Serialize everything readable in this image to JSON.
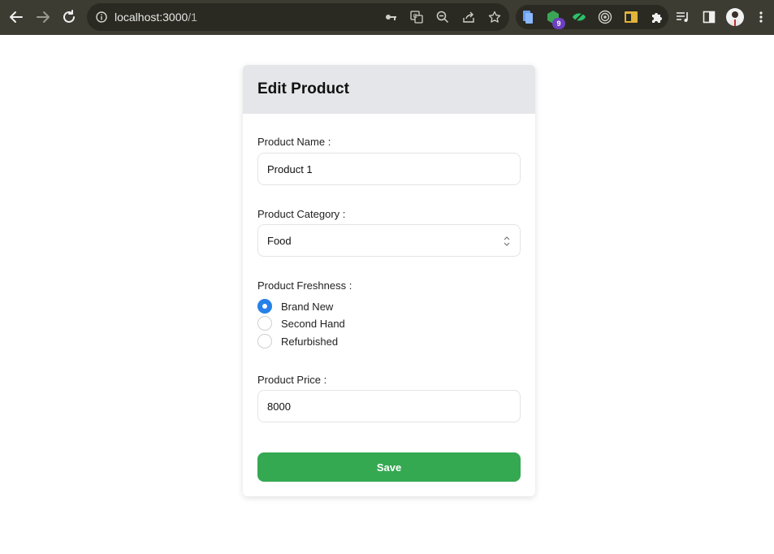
{
  "browser": {
    "url_host": "localhost:3000",
    "url_path": "/1",
    "extension_badge": "9",
    "icons": [
      "back-icon",
      "forward-icon",
      "reload-icon",
      "site-info-icon",
      "key-icon",
      "translate-icon",
      "zoom-out-icon",
      "share-icon",
      "bookmark-star-icon",
      "extension-icon",
      "puzzle-icon",
      "media-icon",
      "side-panel-icon",
      "menu-icon"
    ]
  },
  "form": {
    "title": "Edit Product",
    "name_label": "Product Name :",
    "name_value": "Product 1",
    "category_label": "Product Category :",
    "category_value": "Food",
    "freshness_label": "Product Freshness :",
    "freshness_options": [
      {
        "label": "Brand New",
        "checked": true
      },
      {
        "label": "Second Hand",
        "checked": false
      },
      {
        "label": "Refurbished",
        "checked": false
      }
    ],
    "price_label": "Product Price :",
    "price_value": "8000",
    "save_label": "Save"
  },
  "colors": {
    "chrome": "#3c3c32",
    "header_bg": "#e5e6e9",
    "radio_checked": "#2680e8",
    "save_button": "#35a852"
  }
}
